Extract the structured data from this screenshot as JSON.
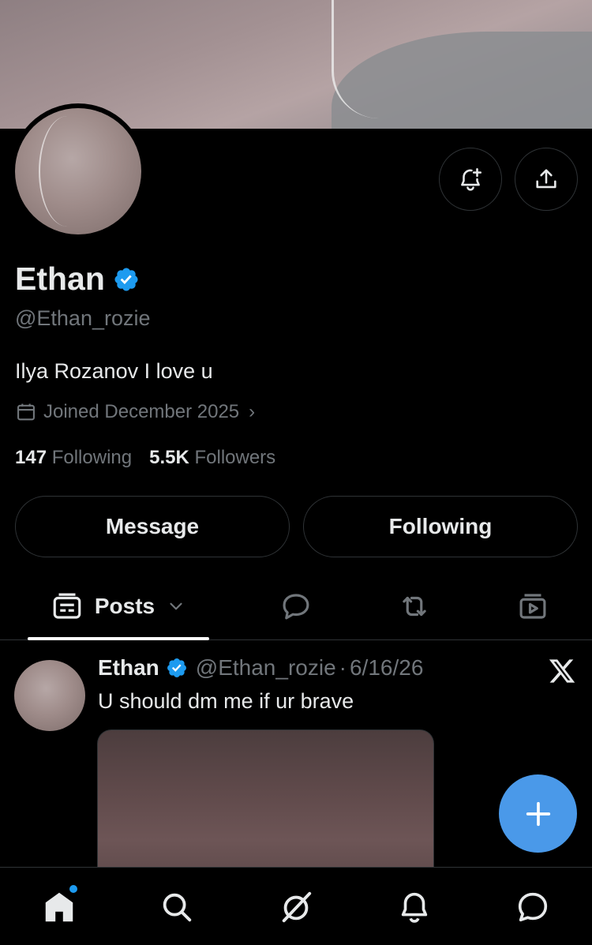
{
  "profile": {
    "name": "Ethan",
    "handle": "@Ethan_rozie",
    "bio": "Ilya Rozanov I love u",
    "joined": "Joined December 2025",
    "following_count": "147",
    "following_label": "Following",
    "followers_count": "5.5K",
    "followers_label": "Followers"
  },
  "actions": {
    "message_label": "Message",
    "following_label": "Following"
  },
  "tabs": {
    "posts_label": "Posts"
  },
  "post": {
    "author": "Ethan",
    "handle": "@Ethan_rozie",
    "separator": "·",
    "date": "6/16/26",
    "text": "U should dm me if ur brave"
  },
  "colors": {
    "accent": "#1d9bf0",
    "fab": "#4a99e9",
    "muted": "#71767b",
    "border": "#2f3336"
  },
  "icons": {
    "notify": "bell-plus-icon",
    "share": "share-icon",
    "calendar": "calendar-icon",
    "verified": "verified-badge-icon",
    "x_logo": "x-logo-icon",
    "compose": "plus-icon",
    "nav": [
      "home-icon",
      "search-icon",
      "grok-icon",
      "notifications-icon",
      "messages-icon"
    ]
  }
}
